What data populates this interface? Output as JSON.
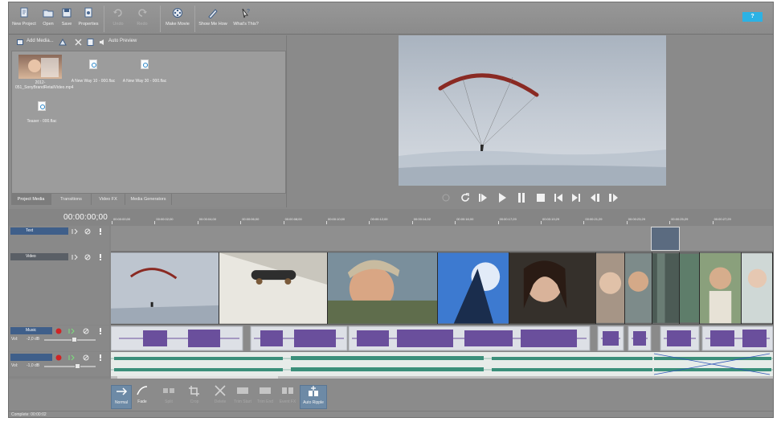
{
  "toolbar": {
    "new_project": "New Project",
    "open": "Open",
    "save": "Save",
    "properties": "Properties",
    "undo": "Undo",
    "redo": "Redo",
    "make_movie": "Make Movie",
    "show_me_how": "Show Me How",
    "whats_this": "What's This?",
    "help": "?"
  },
  "media": {
    "add_media": "Add Media...",
    "auto_preview": "Auto Preview",
    "items": [
      {
        "label": "2012-051_SonyBrandRetailVideo.mp4",
        "kind": "video"
      },
      {
        "label": "A New Way 10 - 000.flac",
        "kind": "audio"
      },
      {
        "label": "A New Way 30 - 000.flac",
        "kind": "audio"
      },
      {
        "label": "Teaser - 000.flac",
        "kind": "audio"
      }
    ],
    "tabs": [
      "Project Media",
      "Transitions",
      "Video FX",
      "Media Generators"
    ],
    "active_tab": "Project Media"
  },
  "timeline": {
    "timecode": "00:00:00;00",
    "ruler": [
      "00:00:00;00",
      "00:00:02;00",
      "00:00:04;00",
      "00:00:06;00",
      "00:00:08;00",
      "00:00:10;00",
      "00:00:12;00",
      "00:00:14;02",
      "00:00:16;00",
      "00:00:17;29",
      "00:00:19;29",
      "00:00:21;29",
      "00:00:23;29",
      "00:00:25;29",
      "00:00:27;29"
    ],
    "tracks": {
      "text": {
        "name": "Text"
      },
      "video": {
        "name": "Video"
      },
      "music": {
        "name": "Music",
        "level_label": "Vol:",
        "level": "-2,0 dB"
      },
      "voice": {
        "name": "",
        "level_label": "Vol:",
        "level": "-1,0 dB"
      }
    }
  },
  "edit_tools": {
    "normal": "Normal",
    "fade": "Fade",
    "split": "Split",
    "crop": "Crop",
    "delete": "Delete",
    "trim_start": "Trim Start",
    "trim_end": "Trim End",
    "event_fx": "Event FX",
    "auto_ripple": "Auto Ripple"
  },
  "status": {
    "text": "Complete: 00:00:02"
  },
  "colors": {
    "accent": "#2cb2e4",
    "music_wave": "#6a4f9c",
    "voice_wave": "#3b8f7a",
    "track_head": "#3f5f8a"
  }
}
